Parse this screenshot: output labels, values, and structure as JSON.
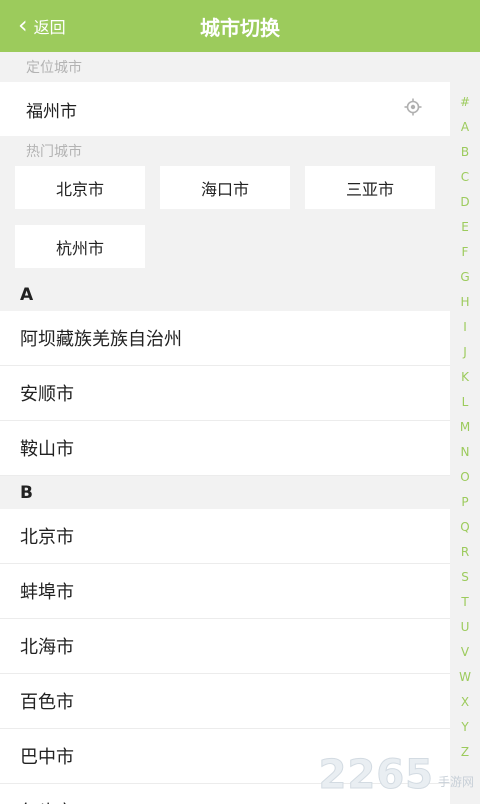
{
  "header": {
    "back_label": "返回",
    "title": "城市切换"
  },
  "located": {
    "caption": "定位城市",
    "city": "福州市",
    "icon": "location-target-icon"
  },
  "hot": {
    "caption": "热门城市",
    "cities": [
      "北京市",
      "海口市",
      "三亚市",
      "杭州市"
    ]
  },
  "groups": [
    {
      "letter": "A",
      "cities": [
        "阿坝藏族羌族自治州",
        "安顺市",
        "鞍山市"
      ]
    },
    {
      "letter": "B",
      "cities": [
        "北京市",
        "蚌埠市",
        "北海市",
        "百色市",
        "巴中市",
        "包头市"
      ]
    }
  ],
  "index": [
    "#",
    "A",
    "B",
    "C",
    "D",
    "E",
    "F",
    "G",
    "H",
    "I",
    "J",
    "K",
    "L",
    "M",
    "N",
    "O",
    "P",
    "Q",
    "R",
    "S",
    "T",
    "U",
    "V",
    "W",
    "X",
    "Y",
    "Z"
  ],
  "watermark": {
    "number": "2265",
    "text": "手游网"
  },
  "colors": {
    "accent": "#9ccb5c",
    "background": "#f2f2f2"
  }
}
